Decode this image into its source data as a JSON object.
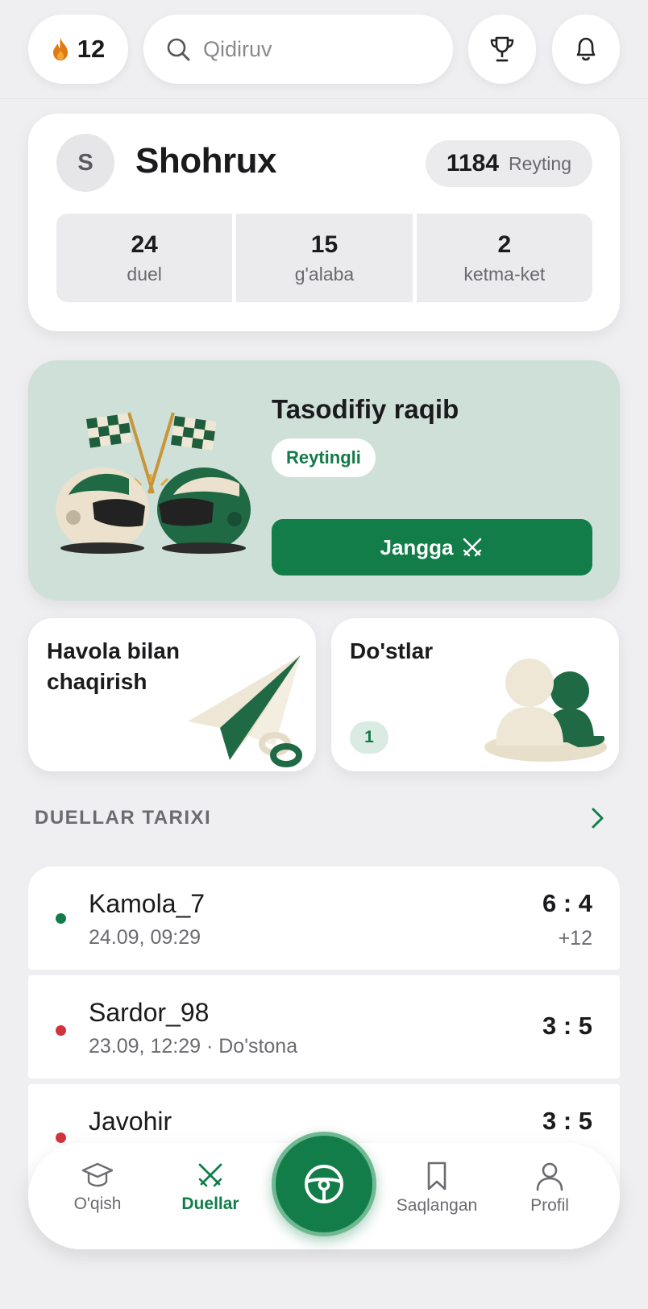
{
  "topbar": {
    "streak_icon": "flame-icon",
    "streak_count": "12",
    "search_placeholder": "Qidiruv",
    "trophy_icon": "trophy-icon",
    "bell_icon": "bell-icon"
  },
  "profile": {
    "avatar_initial": "S",
    "username": "Shohrux",
    "rating_value": "1184",
    "rating_label": "Reyting",
    "stats": [
      {
        "value": "24",
        "label": "duel"
      },
      {
        "value": "15",
        "label": "g'alaba"
      },
      {
        "value": "2",
        "label": "ketma-ket"
      }
    ]
  },
  "random_match": {
    "title": "Tasodifiy raqib",
    "mode_chip": "Reytingli",
    "button_label": "Jangga"
  },
  "invite": {
    "title": "Havola bilan chaqirish"
  },
  "friends": {
    "title": "Do'stlar",
    "count": "1"
  },
  "history": {
    "heading": "DUELLAR TARIXI",
    "items": [
      {
        "name": "Kamola_7",
        "meta": "24.09, 09:29",
        "score": "6 : 4",
        "delta": "+12",
        "result": "win"
      },
      {
        "name": "Sardor_98",
        "meta": "23.09, 12:29 · Do'stona",
        "score": "3 : 5",
        "delta": "",
        "result": "loss"
      },
      {
        "name": "Javohir",
        "meta": "",
        "score": "3 : 5",
        "delta": "",
        "result": "loss"
      }
    ]
  },
  "nav": {
    "items": [
      {
        "label": "O'qish",
        "icon": "graduation-cap-icon"
      },
      {
        "label": "Duellar",
        "icon": "crossed-swords-icon"
      },
      {
        "label": "Saqlangan",
        "icon": "bookmark-icon"
      },
      {
        "label": "Profil",
        "icon": "user-icon"
      }
    ],
    "center_icon": "steering-wheel-icon"
  },
  "colors": {
    "accent": "#127d49",
    "win_dot": "#127d49",
    "loss_dot": "#d0343c",
    "card_green": "#cfe0d9",
    "background": "#efeff1"
  }
}
